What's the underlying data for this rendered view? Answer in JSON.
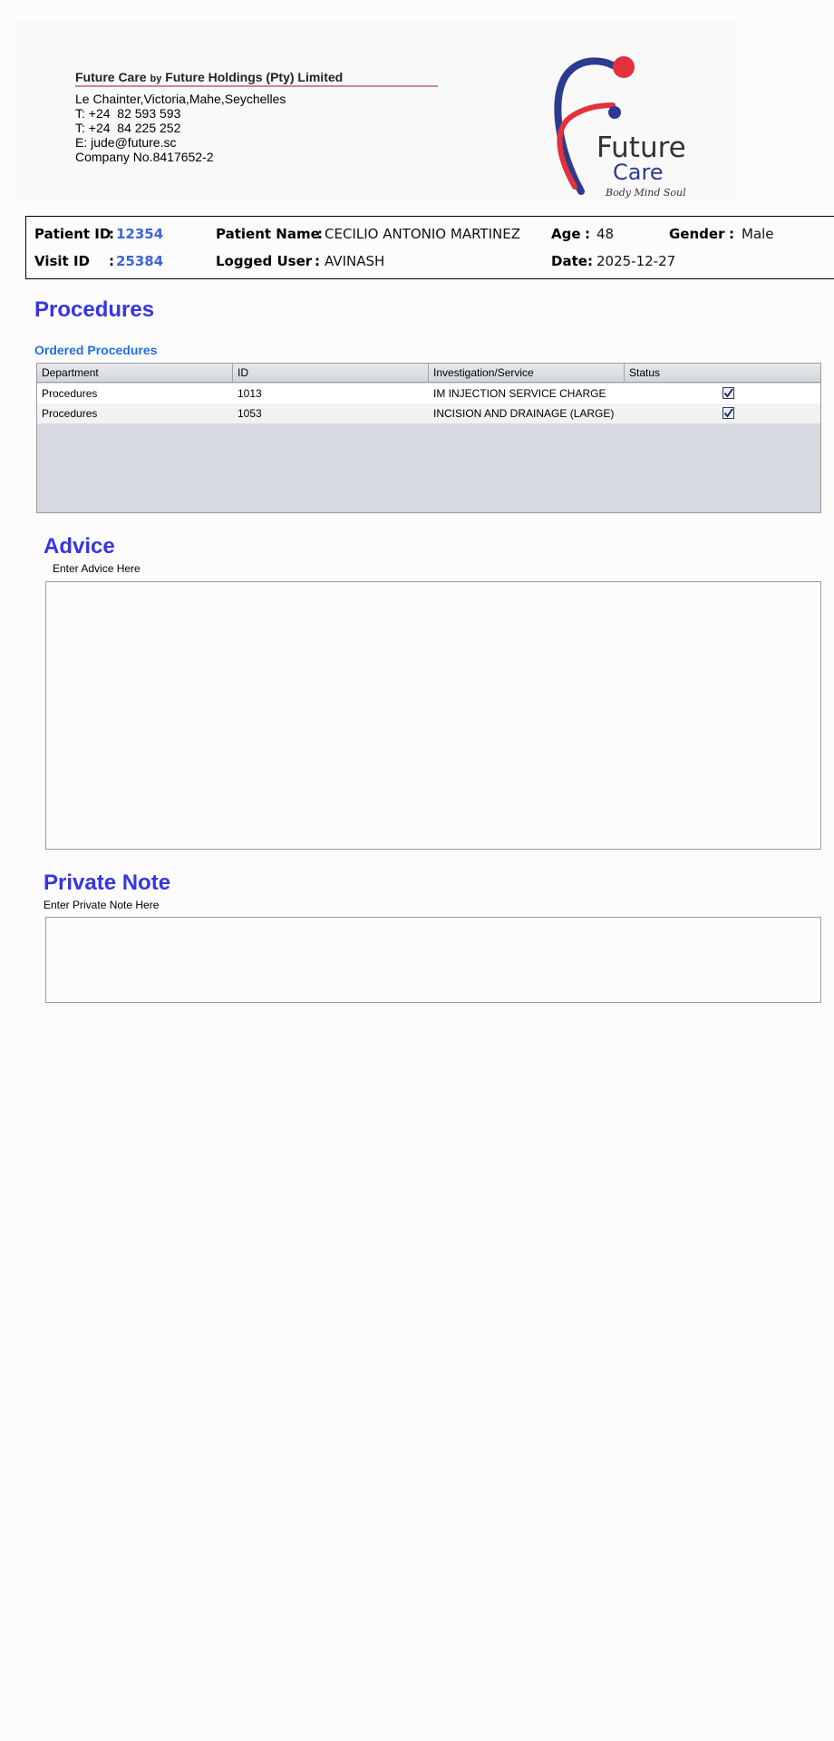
{
  "letterhead": {
    "company_name": "Future Care",
    "company_by": "by",
    "company_holder": "Future Holdings (Pty) Limited",
    "address": "Le Chainter,Victoria,Mahe,Seychelles",
    "phone1": "T: +24  82 593 593",
    "phone2": "T: +24  84 225 252",
    "email": "E: jude@future.sc",
    "company_no": "Company No.8417652-2",
    "logo": {
      "word1": "Future",
      "word2": "Care",
      "tagline": "Body Mind Soul",
      "colors": {
        "red": "#e3313d",
        "blue": "#2e3a8f",
        "text": "#333333"
      }
    }
  },
  "patient": {
    "patient_id_label": "Patient ID",
    "patient_id": "12354",
    "visit_id_label": "Visit ID",
    "visit_id": "25384",
    "patient_name_label": "Patient Name",
    "patient_name": "CECILIO ANTONIO MARTINEZ",
    "logged_user_label": "Logged User",
    "logged_user": "AVINASH",
    "age_label": "Age",
    "age": "48",
    "gender_label": "Gender",
    "gender": "Male",
    "date_label": "Date",
    "date": "2025-12-27",
    "separator": ":"
  },
  "procedures": {
    "title": "Procedures",
    "subtitle": "Ordered Procedures",
    "columns": [
      "Department",
      "ID",
      "Investigation/Service",
      "Status"
    ],
    "rows": [
      {
        "department": "Procedures",
        "id": "1013",
        "service": "IM INJECTION SERVICE CHARGE",
        "status_checked": true
      },
      {
        "department": "Procedures",
        "id": "1053",
        "service": "INCISION AND DRAINAGE (LARGE)",
        "status_checked": true
      }
    ]
  },
  "advice": {
    "title": "Advice",
    "hint": "Enter Advice Here",
    "value": ""
  },
  "private_note": {
    "title": "Private Note",
    "hint": "Enter Private Note Here",
    "value": ""
  },
  "colors": {
    "heading": "#3535e6",
    "subheading": "#1f6fe6",
    "id_value": "#3d64dc"
  }
}
